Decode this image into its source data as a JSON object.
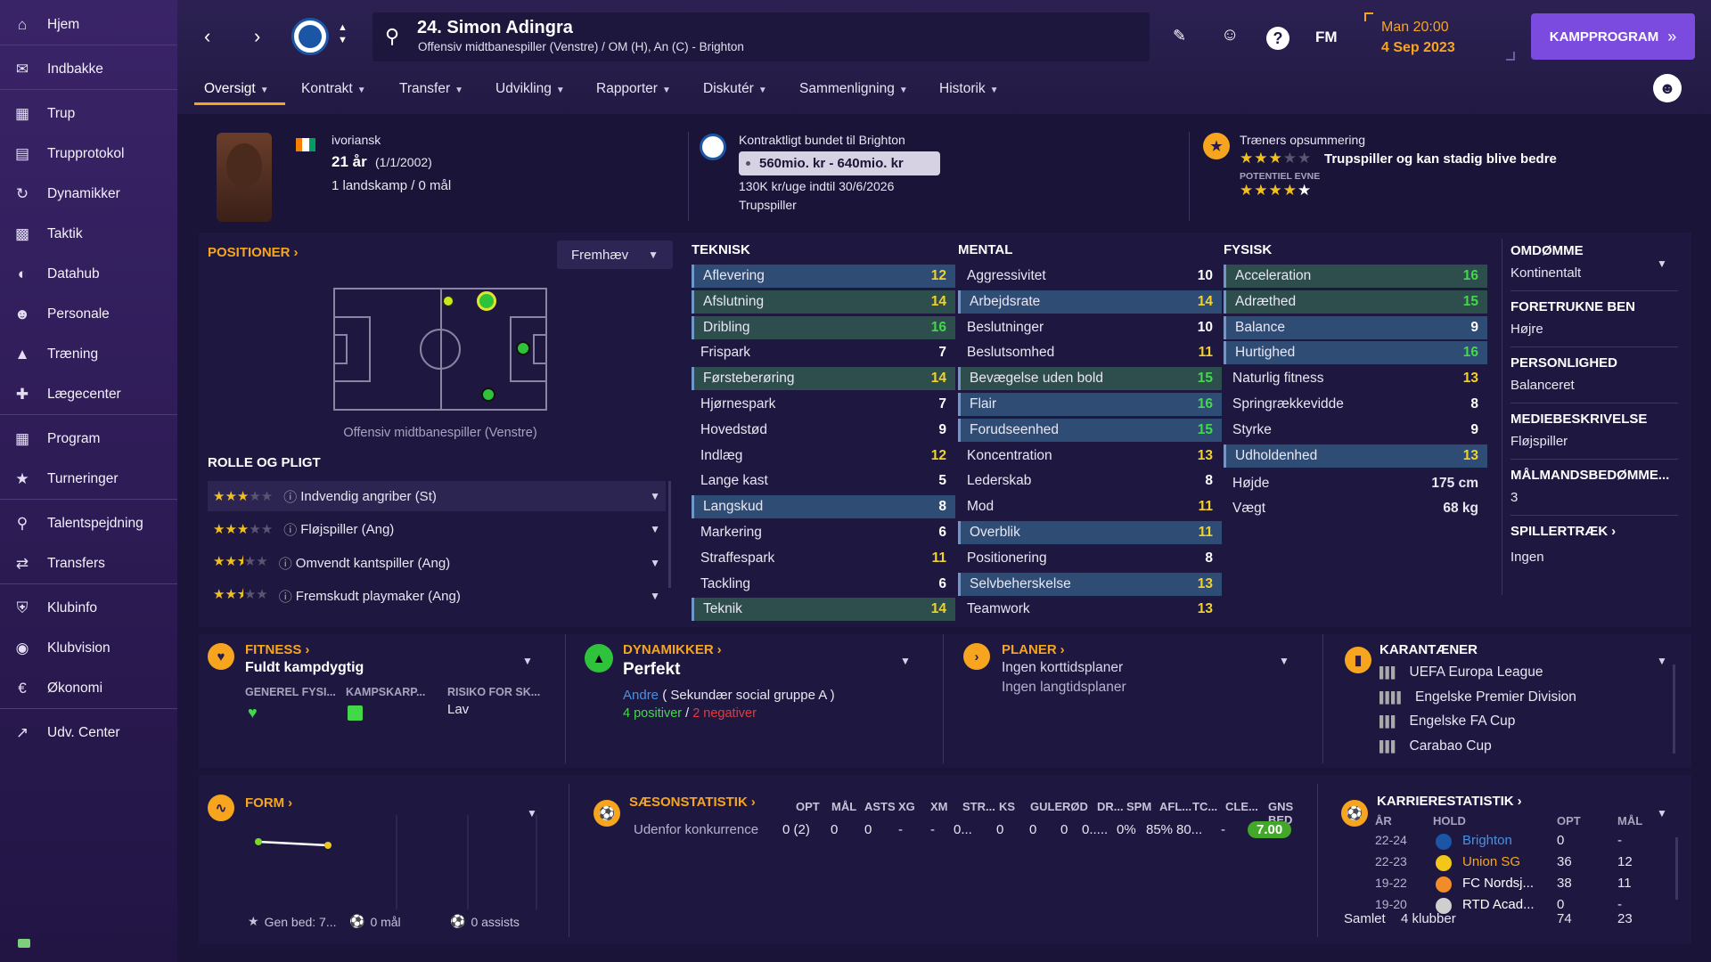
{
  "sidebar": {
    "items": [
      {
        "label": "Hjem",
        "icon": "home-icon"
      },
      {
        "label": "Indbakke",
        "icon": "inbox-icon"
      },
      {
        "label": "Trup",
        "icon": "shirt-icon"
      },
      {
        "label": "Trupprotokol",
        "icon": "clipboard-icon"
      },
      {
        "label": "Dynamikker",
        "icon": "dynamics-icon"
      },
      {
        "label": "Taktik",
        "icon": "tactics-icon"
      },
      {
        "label": "Datahub",
        "icon": "datahub-icon"
      },
      {
        "label": "Personale",
        "icon": "staff-icon"
      },
      {
        "label": "Træning",
        "icon": "training-icon"
      },
      {
        "label": "Lægecenter",
        "icon": "medical-icon"
      },
      {
        "label": "Program",
        "icon": "calendar-icon"
      },
      {
        "label": "Turneringer",
        "icon": "trophy-icon"
      },
      {
        "label": "Talentspejdning",
        "icon": "scout-search-icon"
      },
      {
        "label": "Transfers",
        "icon": "transfer-icon"
      },
      {
        "label": "Klubinfo",
        "icon": "shield-icon"
      },
      {
        "label": "Klubvision",
        "icon": "vision-icon"
      },
      {
        "label": "Økonomi",
        "icon": "finance-icon"
      },
      {
        "label": "Udv. Center",
        "icon": "dev-center-icon"
      }
    ]
  },
  "header": {
    "player_name": "24. Simon Adingra",
    "player_sub": "Offensiv midtbanespiller (Venstre) / OM (H), An (C) - Brighton",
    "fm_label": "FM",
    "date_day": "Man 20:00",
    "date": "4 Sep 2023",
    "continue_label": "KAMPPROGRAM"
  },
  "tabs": [
    {
      "label": "Oversigt"
    },
    {
      "label": "Kontrakt"
    },
    {
      "label": "Transfer"
    },
    {
      "label": "Udvikling"
    },
    {
      "label": "Rapporter"
    },
    {
      "label": "Diskutér"
    },
    {
      "label": "Sammenligning"
    },
    {
      "label": "Historik"
    }
  ],
  "info": {
    "nationality": "ivoriansk",
    "age": "21 år",
    "dob": "(1/1/2002)",
    "caps": "1 landskamp / 0 mål",
    "contract_title": "Kontraktligt bundet til Brighton",
    "value": "560mio. kr - 640mio. kr",
    "wage": "130K kr/uge indtil 30/6/2026",
    "squad_status": "Trupspiller",
    "coach_title": "Træners opsummering",
    "coach_text": "Trupspiller og kan stadig blive bedre",
    "potential_label": "POTENTIEL EVNE",
    "current_stars": 3,
    "potential_stars": 5
  },
  "positions": {
    "title": "POSITIONER",
    "highlight": "Fremhæv",
    "position_label": "Offensiv midtbanespiller (Venstre)"
  },
  "roles": {
    "title": "ROLLE OG PLIGT",
    "items": [
      {
        "label": "Indvendig angriber (St)",
        "stars": 3
      },
      {
        "label": "Fløjspiller (Ang)",
        "stars": 3
      },
      {
        "label": "Omvendt kantspiller (Ang)",
        "stars": 2.5
      },
      {
        "label": "Fremskudt playmaker (Ang)",
        "stars": 2.5
      }
    ]
  },
  "attributes": {
    "teknisk_title": "TEKNISK",
    "mental_title": "MENTAL",
    "fysisk_title": "FYSISK",
    "teknisk": [
      {
        "n": "Aflevering",
        "v": "12",
        "h": "hl"
      },
      {
        "n": "Afslutning",
        "v": "14",
        "h": "hg"
      },
      {
        "n": "Dribling",
        "v": "16",
        "h": "hg"
      },
      {
        "n": "Frispark",
        "v": "7",
        "h": ""
      },
      {
        "n": "Førsteberøring",
        "v": "14",
        "h": "hg"
      },
      {
        "n": "Hjørnespark",
        "v": "7",
        "h": ""
      },
      {
        "n": "Hovedstød",
        "v": "9",
        "h": ""
      },
      {
        "n": "Indlæg",
        "v": "12",
        "h": ""
      },
      {
        "n": "Lange kast",
        "v": "5",
        "h": ""
      },
      {
        "n": "Langskud",
        "v": "8",
        "h": "hl"
      },
      {
        "n": "Markering",
        "v": "6",
        "h": ""
      },
      {
        "n": "Straffespark",
        "v": "11",
        "h": ""
      },
      {
        "n": "Tackling",
        "v": "6",
        "h": ""
      },
      {
        "n": "Teknik",
        "v": "14",
        "h": "hg"
      }
    ],
    "mental": [
      {
        "n": "Aggressivitet",
        "v": "10",
        "h": ""
      },
      {
        "n": "Arbejdsrate",
        "v": "14",
        "h": "hl"
      },
      {
        "n": "Beslutninger",
        "v": "10",
        "h": ""
      },
      {
        "n": "Beslutsomhed",
        "v": "11",
        "h": ""
      },
      {
        "n": "Bevægelse uden bold",
        "v": "15",
        "h": "hg"
      },
      {
        "n": "Flair",
        "v": "16",
        "h": "hl"
      },
      {
        "n": "Forudseenhed",
        "v": "15",
        "h": "hl"
      },
      {
        "n": "Koncentration",
        "v": "13",
        "h": ""
      },
      {
        "n": "Lederskab",
        "v": "8",
        "h": ""
      },
      {
        "n": "Mod",
        "v": "11",
        "h": ""
      },
      {
        "n": "Overblik",
        "v": "11",
        "h": "hl"
      },
      {
        "n": "Positionering",
        "v": "8",
        "h": ""
      },
      {
        "n": "Selvbeherskelse",
        "v": "13",
        "h": "hl"
      },
      {
        "n": "Teamwork",
        "v": "13",
        "h": ""
      }
    ],
    "fysisk": [
      {
        "n": "Acceleration",
        "v": "16",
        "h": "hg"
      },
      {
        "n": "Adræthed",
        "v": "15",
        "h": "hg"
      },
      {
        "n": "Balance",
        "v": "9",
        "h": "hl"
      },
      {
        "n": "Hurtighed",
        "v": "16",
        "h": "hl"
      },
      {
        "n": "Naturlig fitness",
        "v": "13",
        "h": ""
      },
      {
        "n": "Springrækkevidde",
        "v": "8",
        "h": ""
      },
      {
        "n": "Styrke",
        "v": "9",
        "h": ""
      },
      {
        "n": "Udholdenhed",
        "v": "13",
        "h": "hl"
      }
    ],
    "height_label": "Højde",
    "height": "175 cm",
    "weight_label": "Vægt",
    "weight": "68 kg"
  },
  "right": {
    "reputation_t": "OMDØMME",
    "reputation": "Kontinentalt",
    "foot_t": "FORETRUKNE BEN",
    "foot": "Højre",
    "personality_t": "PERSONLIGHED",
    "personality": "Balanceret",
    "media_t": "MEDIEBESKRIVELSE",
    "media": "Fløjspiller",
    "target_t": "MÅLMANDSBEDØMME...",
    "target": "3",
    "traits_t": "SPILLERTRÆK",
    "traits": "Ingen"
  },
  "fitness": {
    "title": "FITNESS",
    "status": "Fuldt kampdygtig",
    "c1": "GENEREL FYSI...",
    "c2": "KAMPSKARP...",
    "c3": "RISIKO FOR SK...",
    "risk": "Lav"
  },
  "dynamics": {
    "title": "DYNAMIKKER",
    "status": "Perfekt",
    "group_link": "Andre",
    "group_text": "( Sekundær social gruppe A )",
    "pos": "4 positiver",
    "sep": "/",
    "neg": "2 negativer"
  },
  "plans": {
    "title": "PLANER",
    "l1": "Ingen korttidsplaner",
    "l2": "Ingen langtidsplaner"
  },
  "bans": {
    "title": "KARANTÆNER",
    "items": [
      "UEFA Europa League",
      "Engelske Premier Division",
      "Engelske FA Cup",
      "Carabao Cup"
    ]
  },
  "form": {
    "title": "FORM",
    "avg": "Gen bed: 7...",
    "goals": "0 mål",
    "assists": "0 assists"
  },
  "season": {
    "title": "SÆSONSTATISTIK",
    "cols": [
      "OPT",
      "MÅL",
      "ASTS",
      "XG",
      "XM",
      "STR...",
      "KS",
      "GULE",
      "RØD",
      "DR...",
      "SPM",
      "AFL...",
      "TC...",
      "CLE...",
      "GNS BED"
    ],
    "row": [
      "Udenfor konkurrence",
      "0 (2)",
      "0",
      "0",
      "-",
      "-",
      "0...",
      "0",
      "0",
      "0",
      "0.....",
      "0%",
      "85%",
      "80...",
      "-",
      "7.00"
    ]
  },
  "career": {
    "title": "KARRIERESTATISTIK",
    "h_year": "ÅR",
    "h_team": "HOLD",
    "h_apps": "OPT",
    "h_goals": "MÅL",
    "rows": [
      {
        "y": "22-24",
        "t": "Brighton",
        "a": "0",
        "g": "-"
      },
      {
        "y": "22-23",
        "t": "Union SG",
        "a": "36",
        "g": "12"
      },
      {
        "y": "19-22",
        "t": "FC Nordsj...",
        "a": "38",
        "g": "11"
      },
      {
        "y": "19-20",
        "t": "RTD Acad...",
        "a": "0",
        "g": "-"
      }
    ],
    "total_label": "Samlet",
    "total_clubs": "4 klubber",
    "total_apps": "74",
    "total_goals": "23"
  }
}
